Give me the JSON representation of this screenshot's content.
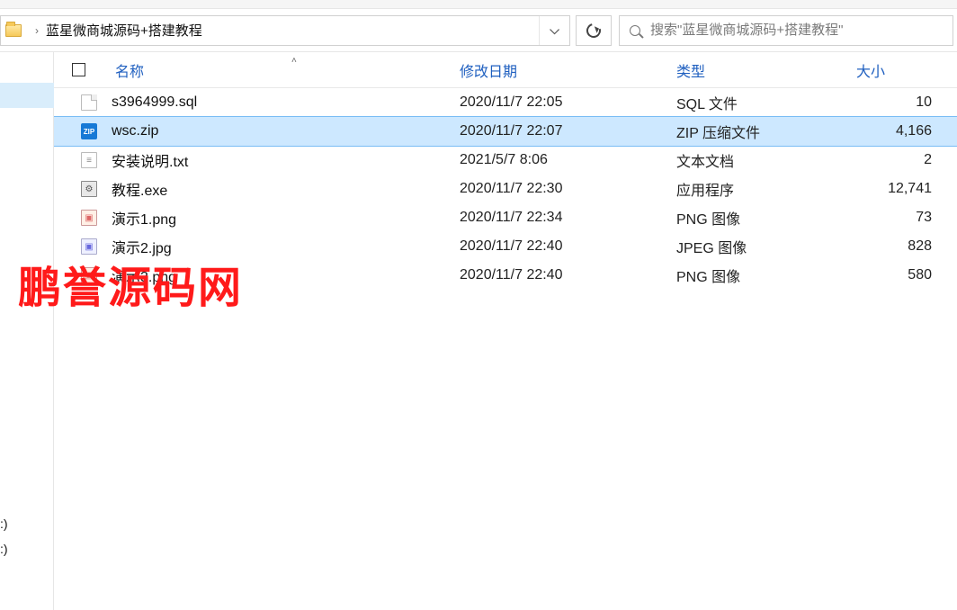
{
  "breadcrumb": {
    "label": "蓝星微商城源码+搭建教程"
  },
  "search": {
    "placeholder": "搜索\"蓝星微商城源码+搭建教程\""
  },
  "columns": {
    "name": "名称",
    "date": "修改日期",
    "type": "类型",
    "size": "大小"
  },
  "nav": {
    "drive1": ":)",
    "drive2": ":)"
  },
  "files": [
    {
      "name": "s3964999.sql",
      "date": "2020/11/7 22:05",
      "type": "SQL 文件",
      "size": "10",
      "icon": "sql",
      "selected": false
    },
    {
      "name": "wsc.zip",
      "date": "2020/11/7 22:07",
      "type": "ZIP 压缩文件",
      "size": "4,166",
      "icon": "zip",
      "selected": true
    },
    {
      "name": "安装说明.txt",
      "date": "2021/5/7 8:06",
      "type": "文本文档",
      "size": "2",
      "icon": "txt",
      "selected": false
    },
    {
      "name": "教程.exe",
      "date": "2020/11/7 22:30",
      "type": "应用程序",
      "size": "12,741",
      "icon": "exe",
      "selected": false
    },
    {
      "name": "演示1.png",
      "date": "2020/11/7 22:34",
      "type": "PNG 图像",
      "size": "73",
      "icon": "png",
      "selected": false
    },
    {
      "name": "演示2.jpg",
      "date": "2020/11/7 22:40",
      "type": "JPEG 图像",
      "size": "828",
      "icon": "jpg",
      "selected": false
    },
    {
      "name": "演示3.png",
      "date": "2020/11/7 22:40",
      "type": "PNG 图像",
      "size": "580",
      "icon": "png",
      "selected": false
    }
  ],
  "watermark": "鹏誉源码网",
  "icons": {
    "folder": "folder-icon",
    "chevron": "›",
    "dropdown": "chevron-down",
    "refresh": "refresh-icon",
    "search": "search-icon",
    "sort_asc": "˄"
  }
}
